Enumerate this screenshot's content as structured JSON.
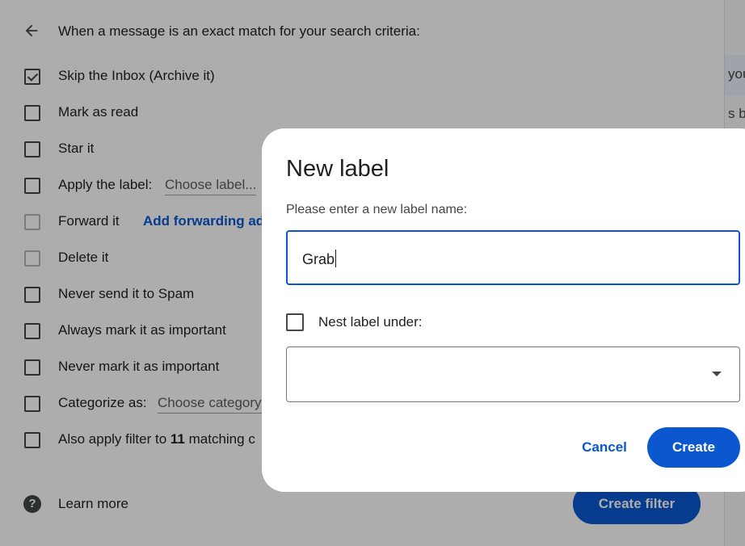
{
  "filter_panel": {
    "header": "When a message is an exact match for your search criteria:",
    "options": [
      {
        "label": "Skip the Inbox (Archive it)",
        "checked": true,
        "disabled": false
      },
      {
        "label": "Mark as read",
        "checked": false,
        "disabled": false
      },
      {
        "label": "Star it",
        "checked": false,
        "disabled": false
      },
      {
        "label": "Apply the label:",
        "checked": false,
        "disabled": false,
        "extra": "Choose label..."
      },
      {
        "label": "Forward it",
        "checked": false,
        "disabled": true,
        "extra": "Add forwarding ad"
      },
      {
        "label": "Delete it",
        "checked": false,
        "disabled": true
      },
      {
        "label": "Never send it to Spam",
        "checked": false,
        "disabled": false
      },
      {
        "label": "Always mark it as important",
        "checked": false,
        "disabled": false
      },
      {
        "label": "Never mark it as important",
        "checked": false,
        "disabled": false
      },
      {
        "label": "Categorize as:",
        "checked": false,
        "disabled": false,
        "extra": "Choose category"
      },
      {
        "label_prefix": "Also apply filter to ",
        "label_count": "11",
        "label_suffix": " matching c",
        "checked": false,
        "disabled": false
      }
    ],
    "learn_more": "Learn more",
    "create_filter_label": "Create filter"
  },
  "right_strip": {
    "fragment_1": "you",
    "fragment_2": "s b"
  },
  "dialog": {
    "title": "New label",
    "prompt": "Please enter a new label name:",
    "label_name_value": "Grab",
    "nest_label": "Nest label under:",
    "nest_checked": false,
    "nest_select_value": "",
    "cancel_label": "Cancel",
    "create_label": "Create"
  },
  "colors": {
    "accent": "#0b57d0",
    "scrim": "rgba(0,0,0,0.32)"
  }
}
